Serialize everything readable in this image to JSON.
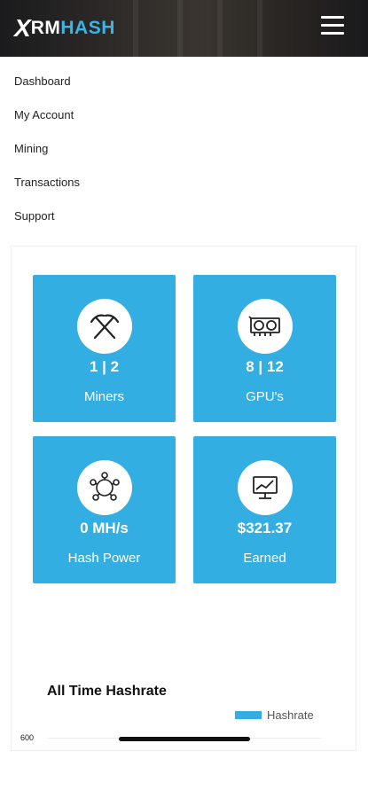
{
  "header": {
    "logo_x": "X",
    "logo_rm": "RM",
    "logo_hash": "HASH"
  },
  "nav": {
    "items": [
      {
        "label": "Dashboard"
      },
      {
        "label": "My Account"
      },
      {
        "label": "Mining"
      },
      {
        "label": "Transactions"
      },
      {
        "label": "Support"
      }
    ]
  },
  "cards": [
    {
      "value": "1 | 2",
      "label": "Miners",
      "icon": "pickaxes-icon"
    },
    {
      "value": "8 | 12",
      "label": "GPU's",
      "icon": "gpu-icon"
    },
    {
      "value": "0 MH/s",
      "label": "Hash Power",
      "icon": "network-hub-icon"
    },
    {
      "value": "$321.37",
      "label": "Earned",
      "icon": "monitor-chart-icon"
    }
  ],
  "chart": {
    "title": "All Time Hashrate",
    "legend_label": "Hashrate",
    "y_tick_top": "600"
  },
  "colors": {
    "accent": "#33aee3",
    "brand_hash": "#39b6e6"
  }
}
